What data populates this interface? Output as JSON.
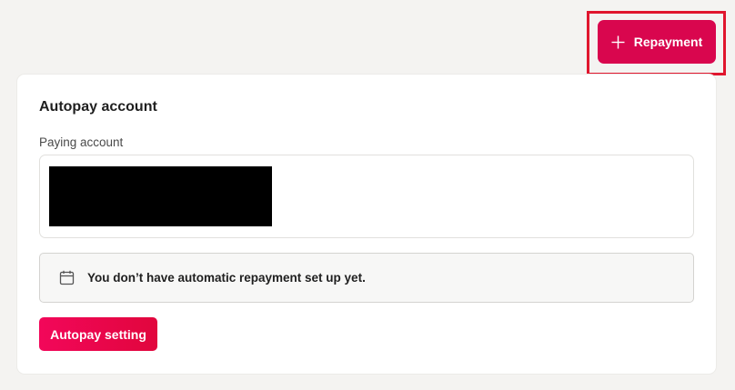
{
  "header": {
    "repayment_button": {
      "label": "Repayment",
      "icon": "plus-icon"
    }
  },
  "autopay_card": {
    "title": "Autopay account",
    "paying_account_label": "Paying account",
    "notice": {
      "icon": "calendar-icon",
      "text": "You don’t have automatic repayment set up yet."
    },
    "setting_button_label": "Autopay setting"
  },
  "colors": {
    "primary": "#d9064e",
    "highlight_frame": "#e0162e",
    "page_background": "#f4f3f1"
  }
}
